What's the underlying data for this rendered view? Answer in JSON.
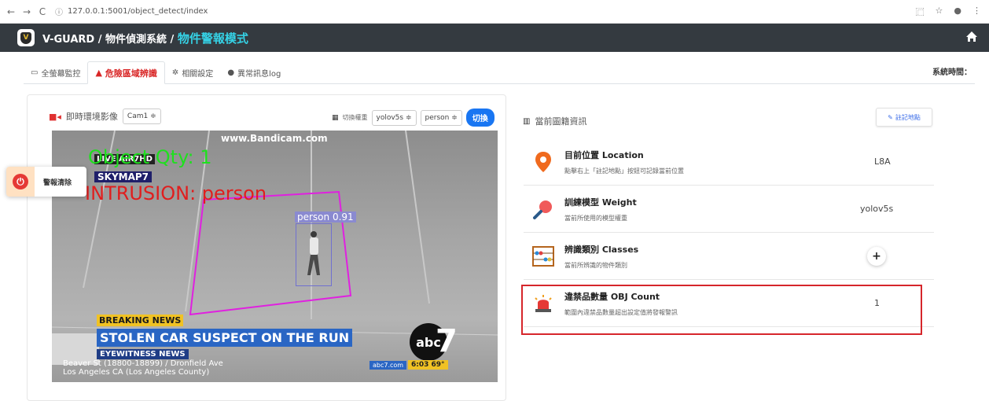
{
  "browser": {
    "url": "127.0.0.1:5001/object_detect/index",
    "back_icon": "arrow-left-icon",
    "forward_icon": "arrow-right-icon",
    "reload_icon": "reload-icon"
  },
  "header": {
    "brand": "V-GUARD / 物件偵測系統 /",
    "mode": "物件警報模式",
    "home_icon": "home-icon"
  },
  "tabs": [
    {
      "label": "全螢幕監控",
      "icon": "monitor-icon"
    },
    {
      "label": "危險區域辨識",
      "icon": "warning-icon",
      "active": true
    },
    {
      "label": "相關設定",
      "icon": "gear-icon"
    },
    {
      "label": "異常訊息log",
      "icon": "chat-icon"
    }
  ],
  "system_time_label": "系統時間：",
  "camera": {
    "label": "即時環境影像",
    "cam_select": "Cam1 ≑",
    "switch_label": "切換權重",
    "weight_select": "yolov5s ≑",
    "class_select": "person ≑",
    "switch_button": "切換"
  },
  "video": {
    "watermark": "www.Bandicam.com",
    "live_tag": "LIVE AIR7HD",
    "skymap": "SKYMAP7",
    "object_qty": "Object Qty: 1",
    "intrusion": "INTRUSION: person",
    "detection_label": "person  0.91",
    "breaking": "BREAKING NEWS",
    "headline": "STOLEN CAR SUSPECT ON THE RUN",
    "eyewitness": "EYEWITNESS NEWS",
    "address_line1": "Beaver St (18800-18899) / Dronfield Ave",
    "address_line2": "Los Angeles CA (Los Angeles County)",
    "abc_url": "abc7.com",
    "abc_time": "6:03  69°",
    "abc_logo": "abc",
    "abc_seven": "7"
  },
  "alarm": {
    "label": "警報清除",
    "icon": "power-icon"
  },
  "info": {
    "header": "當前圖籍資訊",
    "mark_button": "註記地點",
    "rows": [
      {
        "title": "目前位置 Location",
        "desc": "點擊右上「註記地點」按鈕可記錄當前位置",
        "value": "L8A",
        "icon": "map-pin-icon"
      },
      {
        "title": "訓練模型 Weight",
        "desc": "當前所使用的模型權重",
        "value": "yolov5s",
        "icon": "magnifier-icon"
      },
      {
        "title": "辨識類別 Classes",
        "desc": "當前所辨識的物件類別",
        "value": "+",
        "icon": "abacus-icon"
      },
      {
        "title": "違禁品數量 OBJ Count",
        "desc": "範圍內違禁品數量超出設定值將發報警訊",
        "value": "1",
        "icon": "siren-icon"
      }
    ]
  },
  "colors": {
    "header_bg": "#343a40",
    "accent_cyan": "#35d2e6",
    "danger": "#d6262b",
    "primary": "#1976f2"
  }
}
